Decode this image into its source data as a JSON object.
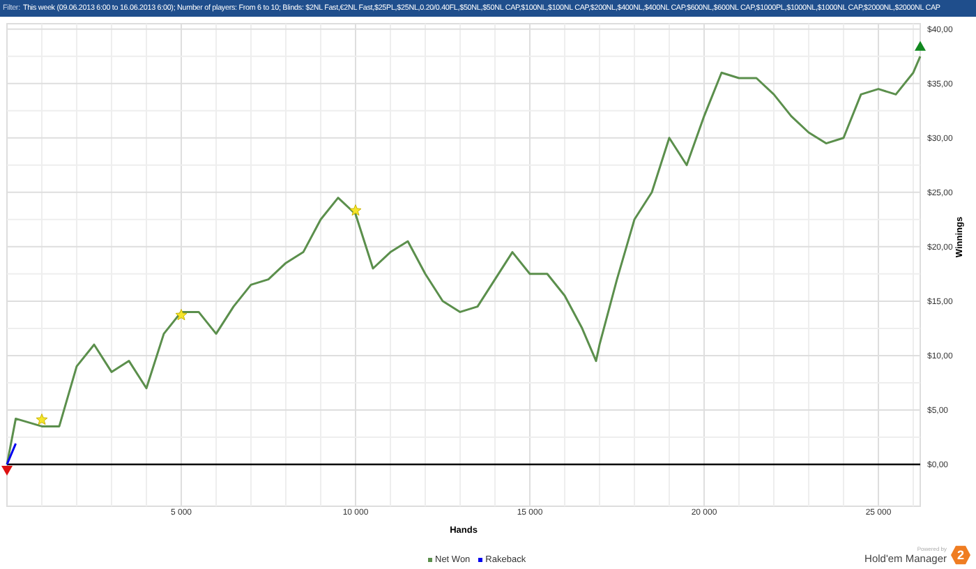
{
  "filter_bar": {
    "label": "Filter:",
    "text": "This week (09.06.2013 6:00 to 16.06.2013 6:00); Number of players: From 6 to 10; Blinds: $2NL Fast,€2NL Fast,$25PL,$25NL,0.20/0.40FL,$50NL,$50NL CAP,$100NL,$100NL CAP,$200NL,$400NL,$400NL CAP,$600NL,$600NL CAP,$1000PL,$1000NL,$1000NL CAP,$2000NL,$2000NL CAP"
  },
  "chart": {
    "chart_data": {
      "type": "line",
      "xlabel": "Hands",
      "ylabel": "Winnings",
      "xlim": [
        0,
        26200
      ],
      "ylim": [
        -3.85,
        40.5
      ],
      "xticks": [
        {
          "value": 5000,
          "label": "5 000"
        },
        {
          "value": 10000,
          "label": "10 000"
        },
        {
          "value": 15000,
          "label": "15 000"
        },
        {
          "value": 20000,
          "label": "20 000"
        },
        {
          "value": 25000,
          "label": "25 000"
        }
      ],
      "yticks": [
        {
          "value": 0,
          "label": "$0,00"
        },
        {
          "value": 5,
          "label": "$5,00"
        },
        {
          "value": 10,
          "label": "$10,00"
        },
        {
          "value": 15,
          "label": "$15,00"
        },
        {
          "value": 20,
          "label": "$20,00"
        },
        {
          "value": 25,
          "label": "$25,00"
        },
        {
          "value": 30,
          "label": "$30,00"
        },
        {
          "value": 35,
          "label": "$35,00"
        },
        {
          "value": 40,
          "label": "$40,00"
        }
      ],
      "x": [
        0,
        250,
        1000,
        1500,
        2000,
        2500,
        3000,
        3500,
        4000,
        4500,
        5000,
        5500,
        6000,
        6500,
        7000,
        7500,
        8000,
        8500,
        9000,
        9500,
        10000,
        10500,
        11000,
        11500,
        12000,
        12500,
        13000,
        13500,
        14000,
        14500,
        15000,
        15500,
        16000,
        16500,
        16900,
        17000,
        17500,
        18000,
        18500,
        19000,
        19500,
        20000,
        20500,
        21000,
        21500,
        22000,
        22500,
        23000,
        23500,
        24000,
        24500,
        25000,
        25500,
        26000,
        26200
      ],
      "series": [
        {
          "name": "Net Won",
          "color": "#5b8f4c",
          "values": [
            0,
            4.2,
            3.5,
            3.5,
            9,
            11,
            8.5,
            9.5,
            7,
            12,
            14,
            14,
            12,
            14.5,
            16.5,
            17,
            18.5,
            19.5,
            22.5,
            24.5,
            23,
            18,
            19.5,
            20.5,
            17.5,
            15,
            14,
            14.5,
            17,
            19.5,
            17.5,
            17.5,
            15.5,
            12.5,
            9.5,
            11,
            17,
            22.5,
            25,
            30,
            27.5,
            32,
            36,
            35.5,
            35.5,
            34,
            32,
            30.5,
            29.5,
            30,
            34,
            34.5,
            34,
            36,
            37.5
          ]
        },
        {
          "name": "Rakeback",
          "color": "#0000ee",
          "values": [
            0,
            1.9,
            null,
            null,
            null,
            null,
            null,
            null,
            null,
            null,
            null,
            null,
            null,
            null,
            null,
            null,
            null,
            null,
            null,
            null,
            null,
            null,
            null,
            null,
            null,
            null,
            null,
            null,
            null,
            null,
            null,
            null,
            null,
            null,
            null,
            null,
            null,
            null,
            null,
            null,
            null,
            null,
            null,
            null,
            null,
            null,
            null,
            null,
            null,
            null,
            null,
            null,
            null,
            null,
            null
          ]
        }
      ],
      "grid": true
    }
  },
  "branding": {
    "caption": "Powered by",
    "name": "Hold'em Manager",
    "badge": "2"
  }
}
